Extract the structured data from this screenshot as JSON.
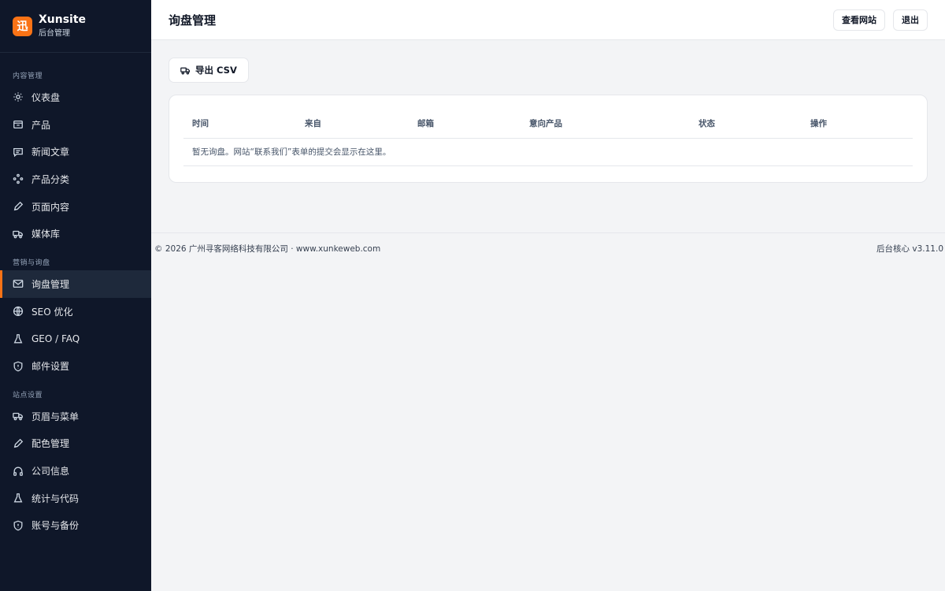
{
  "brand": {
    "logo_char": "迅",
    "name": "Xunsite",
    "subtitle": "后台管理",
    "accent": "#f97316"
  },
  "sidebar": {
    "sections": [
      {
        "label": "内容管理",
        "items": [
          {
            "label": "仪表盘",
            "icon": "sun-icon"
          },
          {
            "label": "产品",
            "icon": "box-icon"
          },
          {
            "label": "新闻文章",
            "icon": "message-icon"
          },
          {
            "label": "产品分类",
            "icon": "grid-dots-icon"
          },
          {
            "label": "页面内容",
            "icon": "pen-icon"
          },
          {
            "label": "媒体库",
            "icon": "truck-icon"
          }
        ]
      },
      {
        "label": "营销与询盘",
        "items": [
          {
            "label": "询盘管理",
            "icon": "mail-icon",
            "active": true
          },
          {
            "label": "SEO 优化",
            "icon": "globe-icon"
          },
          {
            "label": "GEO / FAQ",
            "icon": "flask-icon"
          },
          {
            "label": "邮件设置",
            "icon": "shield-icon"
          }
        ]
      },
      {
        "label": "站点设置",
        "items": [
          {
            "label": "页眉与菜单",
            "icon": "truck-icon"
          },
          {
            "label": "配色管理",
            "icon": "pen-icon"
          },
          {
            "label": "公司信息",
            "icon": "headphones-icon"
          },
          {
            "label": "统计与代码",
            "icon": "flask-icon"
          },
          {
            "label": "账号与备份",
            "icon": "shield-icon"
          }
        ]
      }
    ]
  },
  "header": {
    "title": "询盘管理",
    "view_site": "查看网站",
    "logout": "退出"
  },
  "main": {
    "export_label": "导出 CSV",
    "table": {
      "columns": [
        "时间",
        "来自",
        "邮箱",
        "意向产品",
        "状态",
        "操作"
      ],
      "empty_message": "暂无询盘。网站“联系我们”表单的提交会显示在这里。"
    }
  },
  "footer": {
    "copyright": "© 2026 广州寻客网络科技有限公司 · www.xunkeweb.com",
    "version": "后台核心 v3.11.0"
  }
}
